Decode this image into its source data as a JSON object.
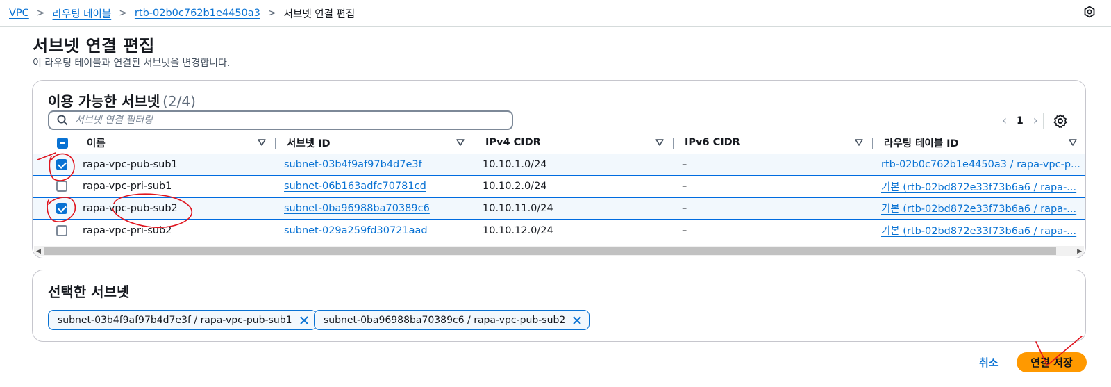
{
  "breadcrumb": {
    "items": [
      "VPC",
      "라우팅 테이블",
      "rtb-02b0c762b1e4450a3"
    ],
    "current": "서브넷 연결 편집"
  },
  "header": {
    "title": "서브넷 연결 편집",
    "description": "이 라우팅 테이블과 연결된 서브넷을 변경합니다."
  },
  "available": {
    "heading": "이용 가능한 서브넷",
    "count": "(2/4)",
    "filter_placeholder": "서브넷 연결 필터링",
    "page": "1",
    "columns": [
      "이름",
      "서브넷 ID",
      "IPv4 CIDR",
      "IPv6 CIDR",
      "라우팅 테이블 ID"
    ],
    "rows": [
      {
        "name": "rapa-vpc-pub-sub1",
        "subnet_id": "subnet-03b4f9af97b4d7e3f",
        "ipv4": "10.10.1.0/24",
        "ipv6": "–",
        "route_table": "rtb-02b0c762b1e4450a3 / rapa-vpc-p...",
        "checked": true
      },
      {
        "name": "rapa-vpc-pri-sub1",
        "subnet_id": "subnet-06b163adfc70781cd",
        "ipv4": "10.10.2.0/24",
        "ipv6": "–",
        "route_table": "기본 (rtb-02bd872e33f73b6a6 / rapa-...",
        "checked": false
      },
      {
        "name": "rapa-vpc-pub-sub2",
        "subnet_id": "subnet-0ba96988ba70389c6",
        "ipv4": "10.10.11.0/24",
        "ipv6": "–",
        "route_table": "기본 (rtb-02bd872e33f73b6a6 / rapa-...",
        "checked": true
      },
      {
        "name": "rapa-vpc-pri-sub2",
        "subnet_id": "subnet-029a259fd30721aad",
        "ipv4": "10.10.12.0/24",
        "ipv6": "–",
        "route_table": "기본 (rtb-02bd872e33f73b6a6 / rapa-...",
        "checked": false
      }
    ]
  },
  "selected": {
    "heading": "선택한 서브넷",
    "tokens": [
      "subnet-03b4f9af97b4d7e3f / rapa-vpc-pub-sub1",
      "subnet-0ba96988ba70389c6 / rapa-vpc-pub-sub2"
    ]
  },
  "footer": {
    "cancel_label": "취소",
    "save_label": "연결 저장"
  },
  "colors": {
    "link": "#0972d3",
    "primary_button": "#ff9900",
    "annotation": "#e0141e"
  }
}
